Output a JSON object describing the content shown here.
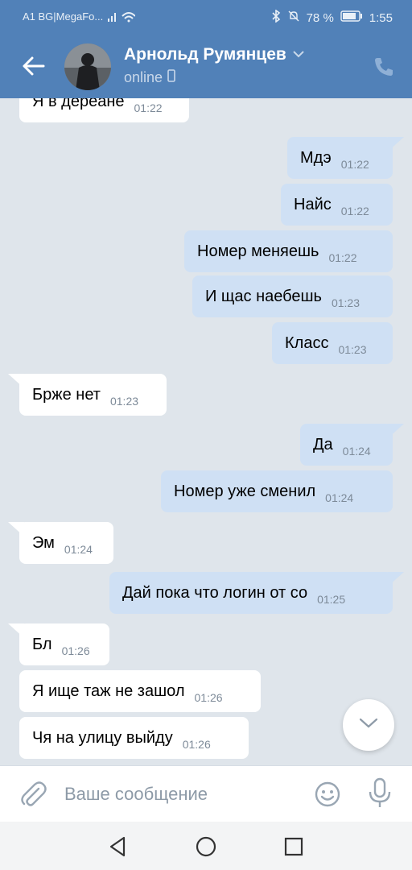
{
  "status_bar": {
    "carrier": "A1 BG|MegaFo...",
    "battery": "78 %",
    "time": "1:55"
  },
  "header": {
    "name": "Арнольд Румянцев",
    "presence": "online"
  },
  "messages": [
    {
      "dir": "in",
      "text": "Я в дереане",
      "time": "01:22"
    },
    {
      "dir": "out",
      "text": "Мдэ",
      "time": "01:22"
    },
    {
      "dir": "out",
      "text": "Найс",
      "time": "01:22"
    },
    {
      "dir": "out",
      "text": "Номер меняешь",
      "time": "01:22"
    },
    {
      "dir": "out",
      "text": "И щас наебешь",
      "time": "01:23"
    },
    {
      "dir": "out",
      "text": "Класс",
      "time": "01:23"
    },
    {
      "dir": "in",
      "text": "Брже нет",
      "time": "01:23"
    },
    {
      "dir": "out",
      "text": "Да",
      "time": "01:24"
    },
    {
      "dir": "out",
      "text": "Номер уже сменил",
      "time": "01:24"
    },
    {
      "dir": "in",
      "text": "Эм",
      "time": "01:24"
    },
    {
      "dir": "out",
      "text": "Дай пока что логин от со",
      "time": "01:25"
    },
    {
      "dir": "in",
      "text": "Бл",
      "time": "01:26"
    },
    {
      "dir": "in",
      "text": "Я ище таж не зашол",
      "time": "01:26"
    },
    {
      "dir": "in",
      "text": "Чя на улицу выйду",
      "time": "01:26"
    }
  ],
  "composer": {
    "placeholder": "Ваше сообщение"
  },
  "icons": {
    "back": "back-arrow-icon",
    "call": "phone-icon",
    "attach": "paperclip-icon",
    "emoji": "smiley-icon",
    "mic": "microphone-icon",
    "scroll": "chevron-down-icon"
  },
  "colors": {
    "header": "#5181b8",
    "chat_bg": "#dfe5eb",
    "bubble_in": "#ffffff",
    "bubble_out": "#cfe0f4"
  }
}
